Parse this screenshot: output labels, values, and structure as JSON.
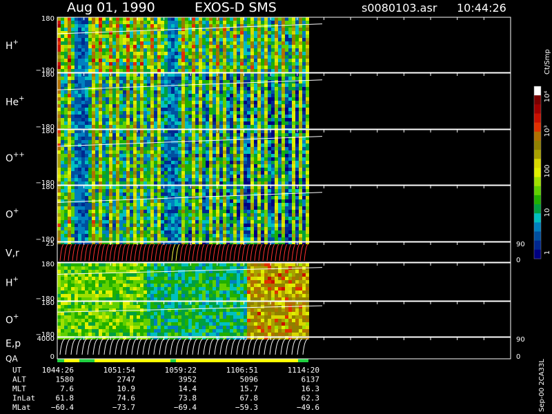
{
  "header": {
    "date": "Aug 01, 1990",
    "instrument": "EXOS-D SMS",
    "file": "s0080103.asr",
    "time": "10:44:26"
  },
  "colorbar": {
    "unit": "Ct/Smp",
    "labels": [
      "10⁴",
      "10³",
      "100",
      "10",
      "1"
    ],
    "colors": [
      "#ffffff",
      "#7a0000",
      "#a00000",
      "#c81000",
      "#e03000",
      "#b07000",
      "#908000",
      "#a8a000",
      "#d8d800",
      "#e0f000",
      "#a0e000",
      "#60d000",
      "#20b000",
      "#00a040",
      "#00c0c0",
      "#0080c0",
      "#0050a0",
      "#002890",
      "#000080"
    ]
  },
  "footer_id": "Sep-00 2CA33L",
  "chart_data": {
    "type": "heatmap",
    "panels": [
      {
        "label": "H",
        "sup": "+",
        "ytop": "180",
        "ybot": "−180",
        "kind": "pitch"
      },
      {
        "label": "He",
        "sup": "+",
        "ytop": "180",
        "ybot": "−180",
        "kind": "pitch"
      },
      {
        "label": "O",
        "sup": "++",
        "ytop": "180",
        "ybot": "−180",
        "kind": "pitch"
      },
      {
        "label": "O",
        "sup": "+",
        "ytop": "180",
        "ybot": "−180",
        "kind": "pitch"
      },
      {
        "label": "V,r",
        "sup": "",
        "ytop": "25",
        "ybot": "",
        "rtop": "90",
        "rbot": "0",
        "kind": "vr"
      },
      {
        "label": "H",
        "sup": "+",
        "ytop": "180",
        "ybot": "−180",
        "kind": "pitch2"
      },
      {
        "label": "O",
        "sup": "+",
        "ytop": "180",
        "ybot": "−180",
        "kind": "pitch2"
      },
      {
        "label": "E,p",
        "label2": "QA",
        "sup": "",
        "ytop": "4000",
        "ybot": "0",
        "rtop": "90",
        "rbot": "0",
        "kind": "ep"
      }
    ],
    "ephemeris": {
      "rows": [
        {
          "name": "UT",
          "values": [
            "1044:26",
            "1051:54",
            "1059:22",
            "1106:51",
            "1114:20"
          ]
        },
        {
          "name": "ALT",
          "values": [
            "1580",
            "2747",
            "3952",
            "5096",
            "6137"
          ]
        },
        {
          "name": "MLT",
          "values": [
            "7.6",
            "10.9",
            "14.4",
            "15.7",
            "16.3"
          ]
        },
        {
          "name": "InLat",
          "values": [
            "61.8",
            "74.6",
            "73.8",
            "67.8",
            "62.3"
          ]
        },
        {
          "name": "MLat",
          "values": [
            "−60.4",
            "−73.7",
            "−69.4",
            "−59.3",
            "−49.6"
          ]
        }
      ]
    }
  }
}
